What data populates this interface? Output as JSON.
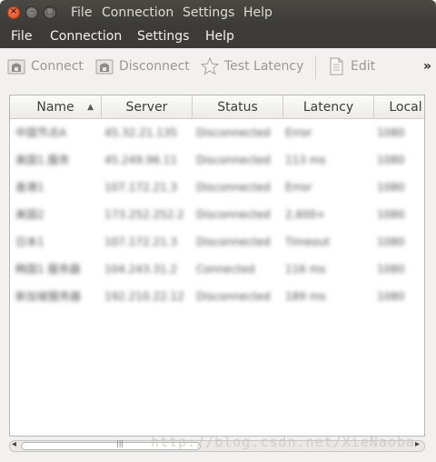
{
  "titlebar": {
    "menu": [
      "File",
      "Connection",
      "Settings",
      "Help"
    ]
  },
  "menubar": {
    "items": [
      "File",
      "Connection",
      "Settings",
      "Help"
    ]
  },
  "toolbar": {
    "connect": "Connect",
    "disconnect": "Disconnect",
    "test_latency": "Test Latency",
    "edit": "Edit",
    "overflow": "»"
  },
  "table": {
    "columns": [
      "Name",
      "Server",
      "Status",
      "Latency",
      "Local"
    ],
    "sort_indicator": "▲",
    "rows": [
      [
        "中国节点A",
        "45.32.21.135",
        "Disconnected",
        "Error",
        "1080"
      ],
      [
        "美国1.服务",
        "45.249.96.11",
        "Disconnected",
        "113 ms",
        "1080"
      ],
      [
        "香港1",
        "107.172.21.3",
        "Disconnected",
        "Error",
        "1080"
      ],
      [
        "美国2",
        "173.252.252.2",
        "Disconnected",
        "2,600+",
        "1080"
      ],
      [
        "日本1",
        "107.172.21.3",
        "Disconnected",
        "Timeout",
        "1080"
      ],
      [
        "韩国1 服务器",
        "104.243.31.2",
        "Connected",
        "116 ms",
        "1080"
      ],
      [
        "新加坡服务器",
        "192.210.22.12",
        "Disconnected",
        "189 ms",
        "1080"
      ]
    ]
  },
  "watermark": "http://blog.csdn.net/XieNaoba"
}
